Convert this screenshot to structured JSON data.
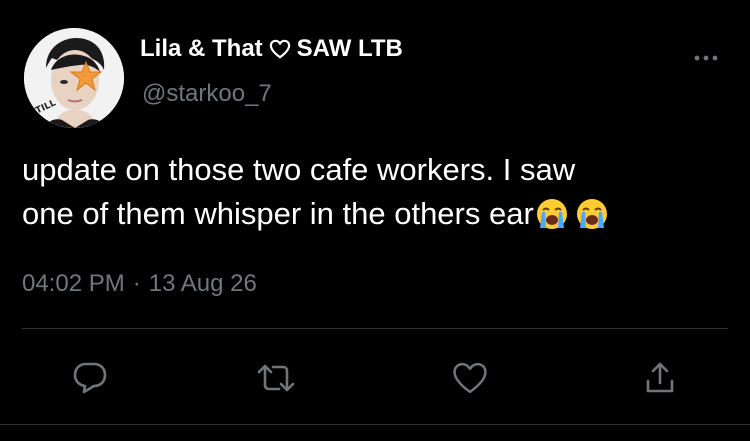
{
  "author": {
    "name_part1": "Lila & That",
    "name_part2": "SAW LTB",
    "handle": "@starkoo_7",
    "avatar_icon": "profile-photo-with-star-sticker",
    "heart_icon": "heart-outline-icon"
  },
  "tweet": {
    "line1": "update on those two cafe workers. I saw",
    "line2": "one of them whisper in the others ear",
    "emojis": [
      "loudly-crying-face",
      "loudly-crying-face"
    ]
  },
  "meta": {
    "time": "04:02 PM",
    "separator": "·",
    "date": "13 Aug 26"
  },
  "actions": [
    {
      "icon": "reply-icon"
    },
    {
      "icon": "retweet-icon"
    },
    {
      "icon": "like-icon"
    },
    {
      "icon": "share-icon"
    }
  ],
  "colors": {
    "background": "#000000",
    "text": "#ffffff",
    "secondary": "#71767b",
    "divider": "#2f3336",
    "accent_star": "#f39a38"
  }
}
